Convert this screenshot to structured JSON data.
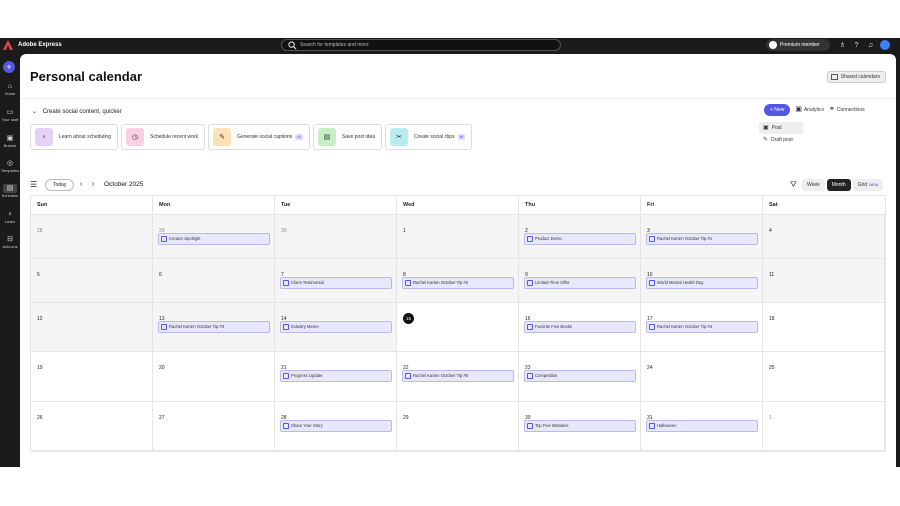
{
  "topbar": {
    "app_title": "Adobe Express",
    "search_placeholder": "Search for templates and more",
    "premium_label": "Premium member"
  },
  "rail": {
    "items": [
      {
        "label": "Home",
        "icon": "home-icon"
      },
      {
        "label": "Your stuff",
        "icon": "folder-icon"
      },
      {
        "label": "Brands",
        "icon": "brand-icon"
      },
      {
        "label": "Templates",
        "icon": "template-icon"
      },
      {
        "label": "Schedule",
        "icon": "calendar-icon"
      },
      {
        "label": "Learn",
        "icon": "bulb-icon"
      },
      {
        "label": "Add-ons",
        "icon": "addon-icon"
      }
    ]
  },
  "header": {
    "title": "Personal calendar",
    "shared_calendars": "Shared calendars"
  },
  "quickstart": {
    "heading": "Create social content, quicker",
    "cards": [
      {
        "label": "Learn about scheduling",
        "color": "#e4d3f7",
        "icon": "bulb-icon",
        "ai": ""
      },
      {
        "label": "Schedule recent work",
        "color": "#f9cfe1",
        "icon": "clock-icon",
        "ai": ""
      },
      {
        "label": "Generate social captions",
        "color": "#fde2b8",
        "icon": "wand-icon",
        "ai": "AI"
      },
      {
        "label": "Save post idea",
        "color": "#c7efc4",
        "icon": "note-icon",
        "ai": ""
      },
      {
        "label": "Create social clips",
        "color": "#b9ecef",
        "icon": "clip-icon",
        "ai": "AI"
      }
    ]
  },
  "tools": {
    "new_label": "+  New",
    "analytics_label": "Analytics",
    "connections_label": "Connections"
  },
  "new_menu": {
    "items": [
      {
        "label": "Post"
      },
      {
        "label": "Draft post"
      }
    ]
  },
  "calendar": {
    "today_label": "Today",
    "month_label": "October 2025",
    "views": {
      "week": "Week",
      "month": "Month",
      "grid": "Grid",
      "grid_badge": "NEW"
    },
    "days_of_week": [
      "Sun",
      "Mon",
      "Tue",
      "Wed",
      "Thu",
      "Fri",
      "Sat"
    ],
    "weeks": [
      [
        {
          "day": "28",
          "muted": true,
          "event": ""
        },
        {
          "day": "29",
          "muted": true,
          "event": "Creator Spotlight"
        },
        {
          "day": "30",
          "muted": true,
          "event": ""
        },
        {
          "day": "1",
          "event": ""
        },
        {
          "day": "2",
          "event": "Product Demo"
        },
        {
          "day": "3",
          "event": "Rachel Karten October Tip #1"
        },
        {
          "day": "4",
          "event": ""
        }
      ],
      [
        {
          "day": "5",
          "event": ""
        },
        {
          "day": "6",
          "event": ""
        },
        {
          "day": "7",
          "event": "Client Testimonial"
        },
        {
          "day": "8",
          "event": "Rachel Karten October Tip #2"
        },
        {
          "day": "9",
          "event": "Limited-Time Offer"
        },
        {
          "day": "10",
          "event": "World Mental Health Day"
        },
        {
          "day": "11",
          "event": ""
        }
      ],
      [
        {
          "day": "12",
          "event": ""
        },
        {
          "day": "13",
          "event": "Rachel Karten October Tip #3"
        },
        {
          "day": "14",
          "event": "Industry Meme"
        },
        {
          "day": "15",
          "today": true,
          "event": ""
        },
        {
          "day": "16",
          "event": "Favorite Five Books"
        },
        {
          "day": "17",
          "event": "Rachel Karten October Tip #4"
        },
        {
          "day": "18",
          "event": ""
        }
      ],
      [
        {
          "day": "19",
          "event": ""
        },
        {
          "day": "20",
          "event": ""
        },
        {
          "day": "21",
          "event": "Progress Update"
        },
        {
          "day": "22",
          "event": "Rachel Karten October Tip #5"
        },
        {
          "day": "23",
          "event": "Competition"
        },
        {
          "day": "24",
          "event": ""
        },
        {
          "day": "25",
          "event": ""
        }
      ],
      [
        {
          "day": "26",
          "event": ""
        },
        {
          "day": "27",
          "event": ""
        },
        {
          "day": "28",
          "event": "Share Your Story"
        },
        {
          "day": "29",
          "event": ""
        },
        {
          "day": "30",
          "event": "Top Five Mistakes"
        },
        {
          "day": "31",
          "event": "Halloween"
        },
        {
          "day": "1",
          "muted": true,
          "event": ""
        }
      ]
    ]
  }
}
